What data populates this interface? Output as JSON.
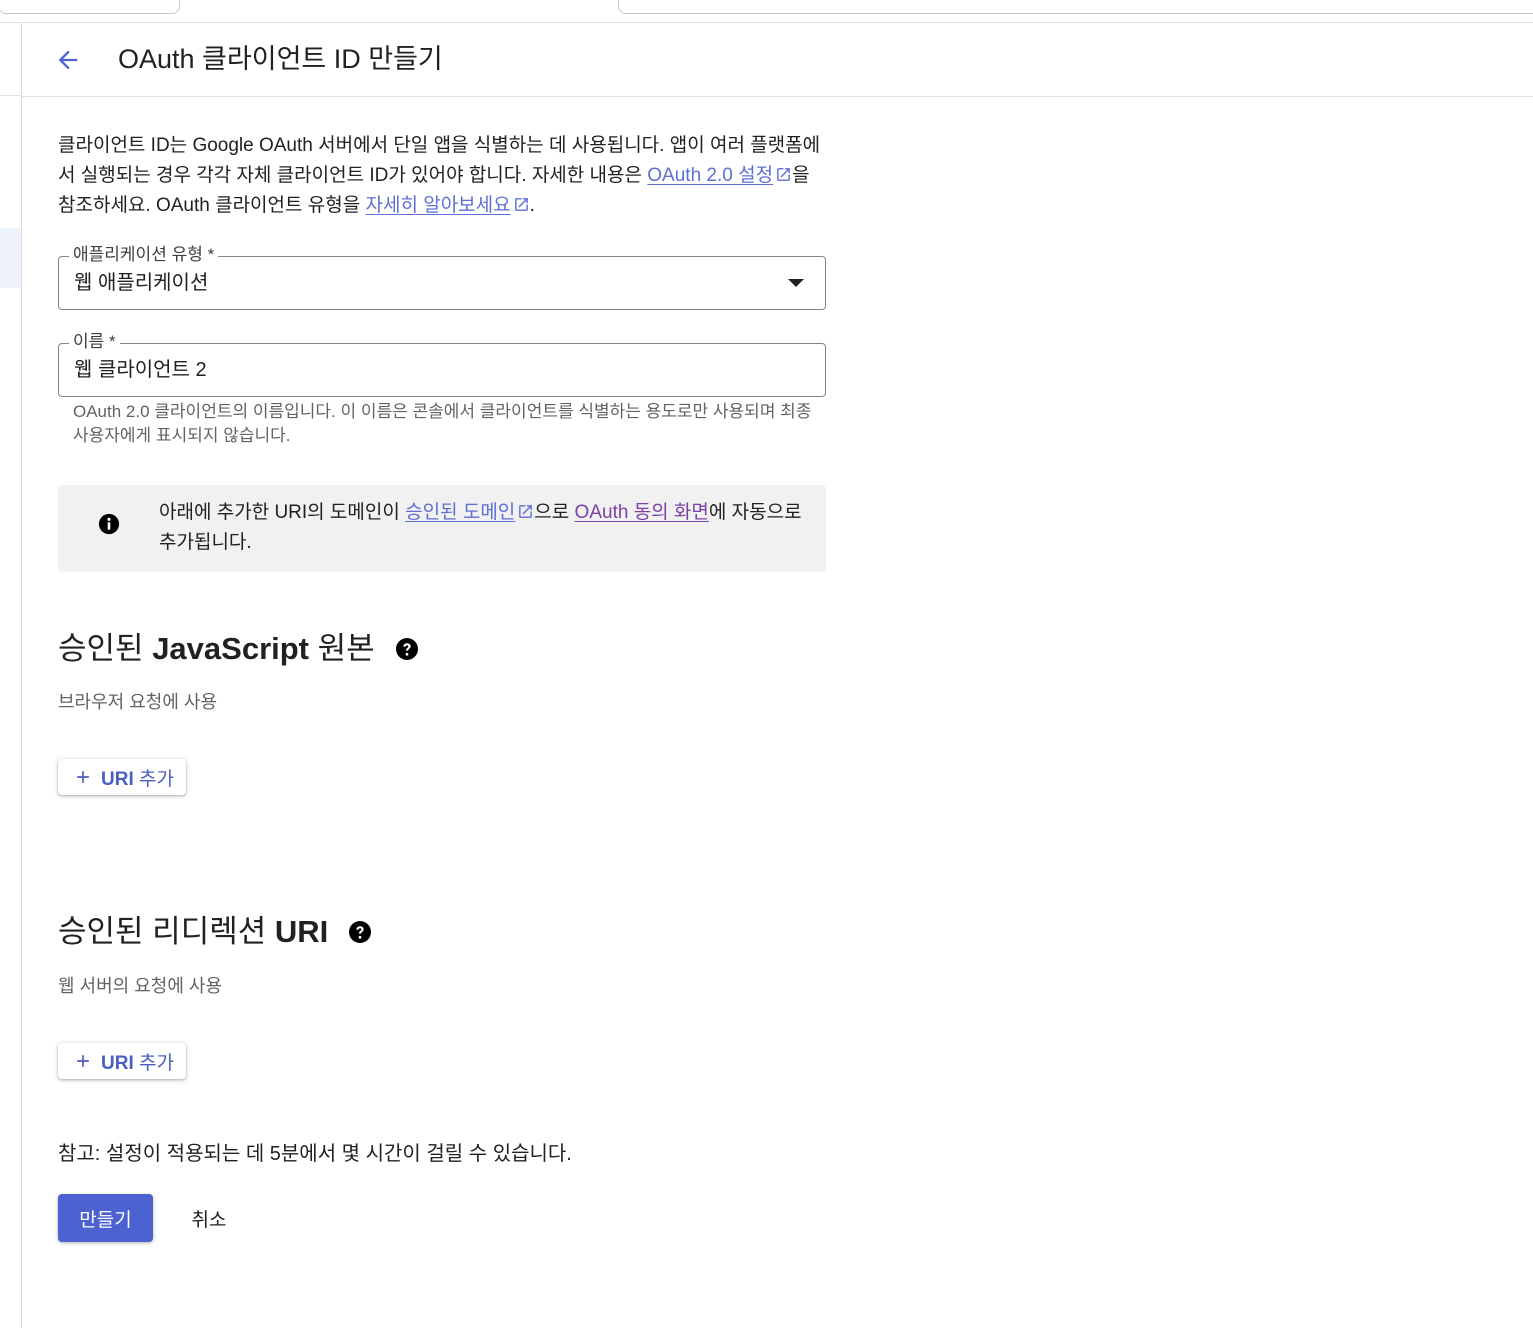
{
  "header": {
    "title": "OAuth 클라이언트 ID 만들기",
    "back_icon": "arrow-back-icon"
  },
  "intro": {
    "text1": "클라이언트 ID는 Google OAuth 서버에서 단일 앱을 식별하는 데 사용됩니다. 앱이 여러 플랫폼에서 실행되는 경우 각각 자체 클라이언트 ID가 있어야 합니다. 자세한 내용은 ",
    "link1": "OAuth 2.0 설정",
    "text2": "을 참조하세요. OAuth 클라이언트 유형을 ",
    "link2": "자세히 알아보세요",
    "text3": "."
  },
  "app_type": {
    "label": "애플리케이션 유형 *",
    "value": "웹 애플리케이션"
  },
  "name_field": {
    "label": "이름 *",
    "value": "웹 클라이언트 2",
    "hint": "OAuth 2.0 클라이언트의 이름입니다. 이 이름은 콘솔에서 클라이언트를 식별하는 용도로만 사용되며 최종 사용자에게 표시되지 않습니다."
  },
  "info": {
    "text1": "아래에 추가한 URI의 도메인이 ",
    "link1": "승인된 도메인",
    "text2": "으로 ",
    "link2": "OAuth 동의 화면",
    "text3": "에 자동으로 추가됩니다."
  },
  "js_origins": {
    "title_prefix": "승인된 ",
    "title_bold": "JavaScript",
    "title_suffix": " 원본",
    "subtitle": "브라우저 요청에 사용",
    "add_bold": "URI",
    "add_text": " 추가"
  },
  "redirect_uris": {
    "title_prefix": "승인된 리디렉션 ",
    "title_bold": "URI",
    "subtitle": "웹 서버의 요청에 사용",
    "add_bold": "URI",
    "add_text": " 추가"
  },
  "footer": {
    "note": "참고: 설정이 적용되는 데 5분에서 몇 시간이 걸릴 수 있습니다.",
    "create_label": "만들기",
    "cancel_label": "취소"
  },
  "colors": {
    "primary": "#4b62d0",
    "link": "#5f6fd4",
    "visited_link": "#7b3fa8",
    "info_bg": "#f1f1f1"
  }
}
